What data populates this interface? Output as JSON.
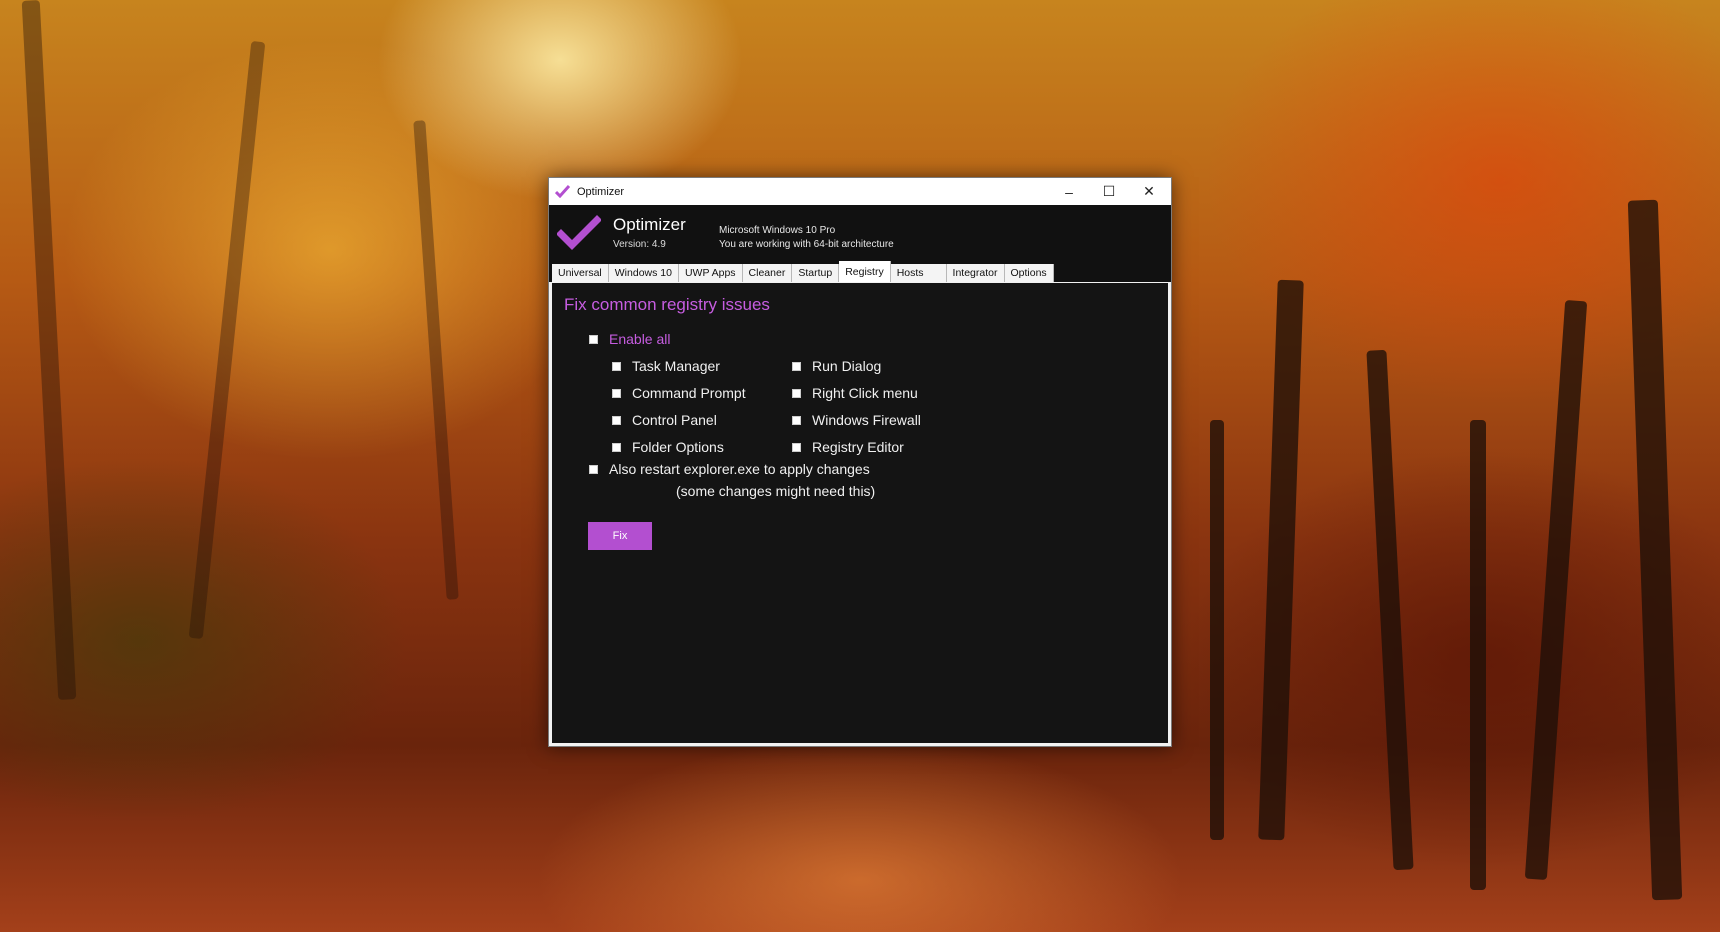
{
  "window": {
    "title": "Optimizer",
    "controls": {
      "minimize": "–",
      "maximize": "☐",
      "close": "✕"
    }
  },
  "header": {
    "app_name": "Optimizer",
    "version": "Version: 4.9",
    "os_name": "Microsoft Windows 10 Pro",
    "os_arch": "You are working with 64-bit architecture"
  },
  "tabs": [
    {
      "label": "Universal"
    },
    {
      "label": "Windows 10"
    },
    {
      "label": "UWP Apps"
    },
    {
      "label": "Cleaner"
    },
    {
      "label": "Startup"
    },
    {
      "label": "Registry",
      "active": true
    },
    {
      "label": "Hosts"
    },
    {
      "label": "Integrator"
    },
    {
      "label": "Options"
    }
  ],
  "registry": {
    "title": "Fix common registry issues",
    "enable_all": "Enable all",
    "options_left": [
      "Task Manager",
      "Command Prompt",
      "Control Panel",
      "Folder Options"
    ],
    "options_right": [
      "Run Dialog",
      "Right Click menu",
      "Windows Firewall",
      "Registry Editor"
    ],
    "restart_label": "Also restart explorer.exe to apply changes",
    "restart_note": "(some changes might need this)",
    "fix_button": "Fix"
  },
  "colors": {
    "accent": "#c65de0",
    "button": "#b34fd0",
    "panel_bg": "#141414"
  }
}
